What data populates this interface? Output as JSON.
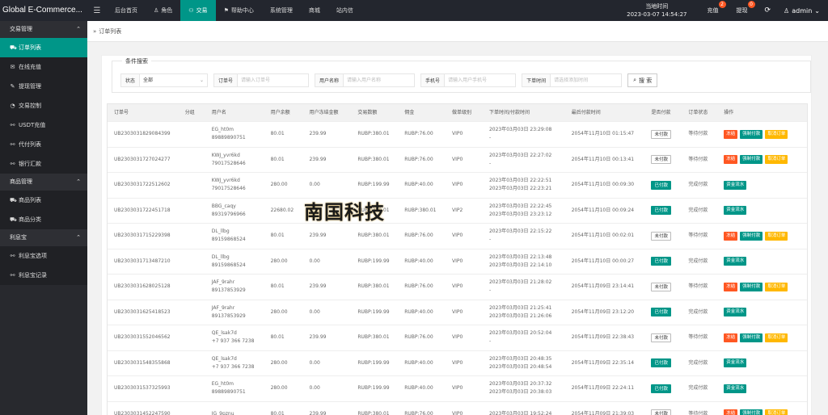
{
  "brand": "Global E-Commerce...",
  "topnav": [
    {
      "label": "后台首页",
      "icon": "none",
      "active": false
    },
    {
      "label": "角色",
      "icon": "user-icon",
      "active": false
    },
    {
      "label": "交易",
      "icon": "users-icon",
      "active": true
    },
    {
      "label": "帮助中心",
      "icon": "flag-icon",
      "active": false
    },
    {
      "label": "系统管理",
      "icon": "none",
      "active": false
    },
    {
      "label": "商城",
      "icon": "none",
      "active": false
    },
    {
      "label": "站内信",
      "icon": "none",
      "active": false
    }
  ],
  "header": {
    "time_label": "当地时间",
    "time_value": "2023-03-07 14:54:27",
    "recharge_label": "充值",
    "recharge_badge": "2",
    "withdraw_label": "提现",
    "withdraw_badge": "0",
    "user": "admin"
  },
  "sidebar": {
    "groups": [
      {
        "title": "交易管理",
        "items": [
          {
            "label": "订单列表",
            "icon": "cart-icon",
            "active": true
          },
          {
            "label": "在线充值",
            "icon": "comment-icon",
            "active": false
          },
          {
            "label": "提现管理",
            "icon": "edit-icon",
            "active": false
          },
          {
            "label": "交易控制",
            "icon": "dashboard-icon",
            "active": false
          },
          {
            "label": "USDT充值",
            "icon": "link-icon",
            "active": false
          },
          {
            "label": "代付列表",
            "icon": "link-icon",
            "active": false
          },
          {
            "label": "银行汇款",
            "icon": "link-icon",
            "active": false
          }
        ]
      },
      {
        "title": "商品管理",
        "items": [
          {
            "label": "商品列表",
            "icon": "cart-icon",
            "active": false
          },
          {
            "label": "商品分类",
            "icon": "cart-icon",
            "active": false
          }
        ]
      },
      {
        "title": "利息宝",
        "items": [
          {
            "label": "利息宝选项",
            "icon": "link-icon",
            "active": false
          },
          {
            "label": "利息宝记录",
            "icon": "link-icon",
            "active": false
          }
        ]
      }
    ]
  },
  "breadcrumb": "订单列表",
  "filters": {
    "legend": "条件搜索",
    "status_label": "状态",
    "status_value": "全部",
    "order_label": "订单号",
    "order_placeholder": "请输入订单号",
    "username_label": "用户名称",
    "username_placeholder": "请输入用户名称",
    "phone_label": "手机号",
    "phone_placeholder": "请输入用户手机号",
    "time_label": "下单时间",
    "time_placeholder": "请选择添加时间",
    "search_label": "搜 索"
  },
  "table": {
    "headers": [
      "订单号",
      "分组",
      "用户名",
      "用户余额",
      "用户冻结金额",
      "交易数额",
      "佣金",
      "做单级别",
      "下单时间/付款时间",
      "最后付款时间",
      "是否付款",
      "订单状态",
      "操作"
    ],
    "rows": [
      {
        "order": "UB2303031829084399",
        "group": "",
        "user": "EG_ht0m",
        "phone": "89889890751",
        "balance": "80.01",
        "frozen": "239.99",
        "amount": "RUBP:380.01",
        "commission": "RUBP:76.00",
        "level": "VIP0",
        "t1": "2023年03月03日 23:29:08",
        "t2": "-",
        "last": "2054年11月10日 01:15:47",
        "paid": "未付款",
        "state": "等待付款",
        "ops": [
          "冻结",
          "强制付款",
          "取消订单"
        ]
      },
      {
        "order": "UB2303031727024277",
        "group": "",
        "user": "KWJ_yvr6kd",
        "phone": "79017528646",
        "balance": "80.01",
        "frozen": "239.99",
        "amount": "RUBP:380.01",
        "commission": "RUBP:76.00",
        "level": "VIP0",
        "t1": "2023年03月03日 22:27:02",
        "t2": "-",
        "last": "2054年11月10日 00:13:41",
        "paid": "未付款",
        "state": "等待付款",
        "ops": [
          "冻结",
          "强制付款",
          "取消订单"
        ]
      },
      {
        "order": "UB2303031722512602",
        "group": "",
        "user": "KWJ_yvr6kd",
        "phone": "79017528646",
        "balance": "280.00",
        "frozen": "0.00",
        "amount": "RUBP:199.99",
        "commission": "RUBP:40.00",
        "level": "VIP0",
        "t1": "2023年03月03日 22:22:51",
        "t2": "2023年03月03日 22:23:21",
        "last": "2054年11月10日 00:09:30",
        "paid": "已付款",
        "state": "完成付款",
        "ops": [
          "资金流水"
        ]
      },
      {
        "order": "UB2303031722451718",
        "group": "",
        "user": "BBG_caqy",
        "phone": "89319796966",
        "balance": "22680.02",
        "frozen": "",
        "amount": "RUBP:380.01",
        "commission": "RUBP:380.01",
        "level": "VIP2",
        "t1": "2023年03月03日 22:22:45",
        "t2": "2023年03月03日 23:23:12",
        "last": "2054年11月10日 00:09:24",
        "paid": "已付款",
        "state": "完成付款",
        "ops": [
          "资金流水"
        ]
      },
      {
        "order": "UB2303031715229398",
        "group": "",
        "user": "DL_llbg",
        "phone": "89159868524",
        "balance": "80.01",
        "frozen": "239.99",
        "amount": "RUBP:380.01",
        "commission": "RUBP:76.00",
        "level": "VIP0",
        "t1": "2023年03月03日 22:15:22",
        "t2": "-",
        "last": "2054年11月10日 00:02:01",
        "paid": "未付款",
        "state": "等待付款",
        "ops": [
          "冻结",
          "强制付款",
          "取消订单"
        ]
      },
      {
        "order": "UB2303031713487210",
        "group": "",
        "user": "DL_llbg",
        "phone": "89159868524",
        "balance": "280.00",
        "frozen": "0.00",
        "amount": "RUBP:199.99",
        "commission": "RUBP:40.00",
        "level": "VIP0",
        "t1": "2023年03月03日 22:13:48",
        "t2": "2023年03月03日 22:14:10",
        "last": "2054年11月10日 00:00:27",
        "paid": "已付款",
        "state": "完成付款",
        "ops": [
          "资金流水"
        ]
      },
      {
        "order": "UB2303031628025128",
        "group": "",
        "user": "JAF_9rahr",
        "phone": "89137853929",
        "balance": "80.01",
        "frozen": "239.99",
        "amount": "RUBP:380.01",
        "commission": "RUBP:76.00",
        "level": "VIP0",
        "t1": "2023年03月03日 21:28:02",
        "t2": "-",
        "last": "2054年11月09日 23:14:41",
        "paid": "未付款",
        "state": "等待付款",
        "ops": [
          "冻结",
          "强制付款",
          "取消订单"
        ]
      },
      {
        "order": "UB2303031625418523",
        "group": "",
        "user": "JAF_9rahr",
        "phone": "89137853929",
        "balance": "280.00",
        "frozen": "0.00",
        "amount": "RUBP:199.99",
        "commission": "RUBP:40.00",
        "level": "VIP0",
        "t1": "2023年03月03日 21:25:41",
        "t2": "2023年03月03日 21:26:06",
        "last": "2054年11月09日 23:12:20",
        "paid": "已付款",
        "state": "完成付款",
        "ops": [
          "资金流水"
        ]
      },
      {
        "order": "UB2303031552046562",
        "group": "",
        "user": "QE_lsak7d",
        "phone": "+7 937 366 7238",
        "balance": "80.01",
        "frozen": "239.99",
        "amount": "RUBP:380.01",
        "commission": "RUBP:76.00",
        "level": "VIP0",
        "t1": "2023年03月03日 20:52:04",
        "t2": "-",
        "last": "2054年11月09日 22:38:43",
        "paid": "未付款",
        "state": "等待付款",
        "ops": [
          "冻结",
          "强制付款",
          "取消订单"
        ]
      },
      {
        "order": "UB2303031548355868",
        "group": "",
        "user": "QE_lsak7d",
        "phone": "+7 937 366 7238",
        "balance": "280.00",
        "frozen": "0.00",
        "amount": "RUBP:199.99",
        "commission": "RUBP:40.00",
        "level": "VIP0",
        "t1": "2023年03月03日 20:48:35",
        "t2": "2023年03月03日 20:48:54",
        "last": "2054年11月09日 22:35:14",
        "paid": "已付款",
        "state": "完成付款",
        "ops": [
          "资金流水"
        ]
      },
      {
        "order": "UB2303031537325993",
        "group": "",
        "user": "EG_ht0m",
        "phone": "89889890751",
        "balance": "280.00",
        "frozen": "0.00",
        "amount": "RUBP:199.99",
        "commission": "RUBP:40.00",
        "level": "VIP0",
        "t1": "2023年03月03日 20:37:32",
        "t2": "2023年03月03日 20:38:03",
        "last": "2054年11月09日 22:24:11",
        "paid": "已付款",
        "state": "完成付款",
        "ops": [
          "资金流水"
        ]
      },
      {
        "order": "UB2303031452247590",
        "group": "",
        "user": "JG_9pznu",
        "phone": "",
        "balance": "80.01",
        "frozen": "239.99",
        "amount": "RUBP:380.01",
        "commission": "RUBP:76.00",
        "level": "VIP0",
        "t1": "2023年03月03日 19:52:24",
        "t2": "",
        "last": "2054年11月09日 21:39:03",
        "paid": "未付款",
        "state": "等待付款",
        "ops": [
          "冻结",
          "强制付款",
          "取消订单"
        ]
      }
    ]
  },
  "watermark": "南国科技",
  "colors": {
    "accent": "#009688",
    "danger": "#ff5722",
    "warning": "#ffb800",
    "topbar": "#23262e",
    "sidebar": "#28292e"
  }
}
